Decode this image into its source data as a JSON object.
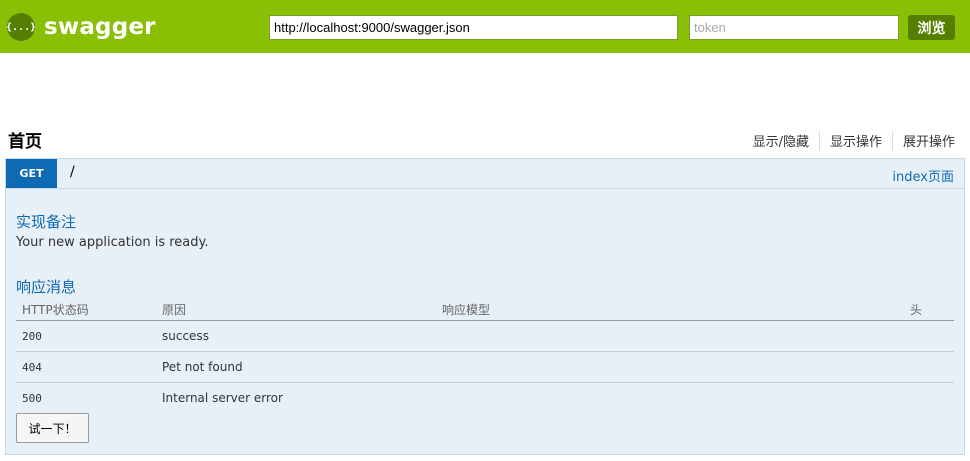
{
  "header": {
    "logo_icon_text": "{...}",
    "logo_text": "swagger",
    "url_value": "http://localhost:9000/swagger.json",
    "token_placeholder": "token",
    "explore_label": "浏览",
    "background_color": "#89bf04",
    "button_color": "#547f00"
  },
  "resource": {
    "title": "首页",
    "links": [
      "显示/隐藏",
      "显示操作",
      "展开操作"
    ]
  },
  "operation": {
    "method": "GET",
    "method_color": "#0f6ab4",
    "path": "/",
    "summary": "index页面",
    "notes_title": "实现备注",
    "notes_text": "Your new application is ready.",
    "responses_title": "响应消息",
    "table": {
      "headers": [
        "HTTP状态码",
        "原因",
        "响应模型",
        "头"
      ],
      "rows": [
        {
          "code": "200",
          "reason": "success",
          "model": "",
          "headers": ""
        },
        {
          "code": "404",
          "reason": "Pet not found",
          "model": "",
          "headers": ""
        },
        {
          "code": "500",
          "reason": "Internal server error",
          "model": "",
          "headers": ""
        }
      ]
    },
    "try_button_label": "试一下！"
  }
}
